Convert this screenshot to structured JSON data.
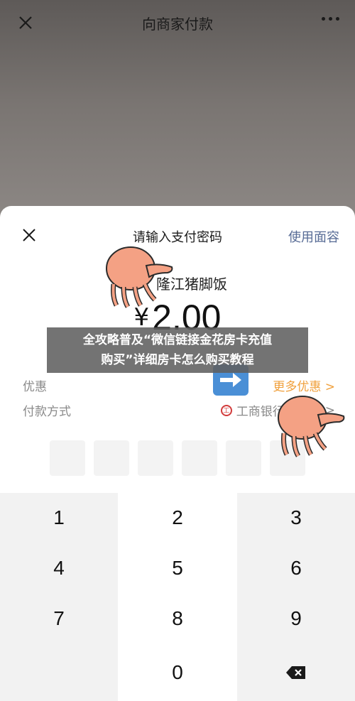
{
  "header": {
    "title": "向商家付款"
  },
  "sheet": {
    "title": "请输入支付密码",
    "face_pay": "使用面容",
    "merchant": "隆江猪脚饭",
    "currency": "¥",
    "amount": "2.00",
    "discount_label": "优惠",
    "discount_link": "更多优惠 >",
    "payment_label": "付款方式",
    "bank_icon_text": "工",
    "payment_method": "工商银行储蓄卡",
    "payment_chevron": ">"
  },
  "keypad": [
    "1",
    "2",
    "3",
    "4",
    "5",
    "6",
    "7",
    "8",
    "9",
    "0"
  ],
  "banner": {
    "line1": "全攻略普及“微信链接金花房卡充值",
    "line2": "购买”详细房卡怎么购买教程"
  },
  "colors": {
    "link": "#576b95",
    "orange": "#f0a03c",
    "octopus": "#f4a184"
  }
}
